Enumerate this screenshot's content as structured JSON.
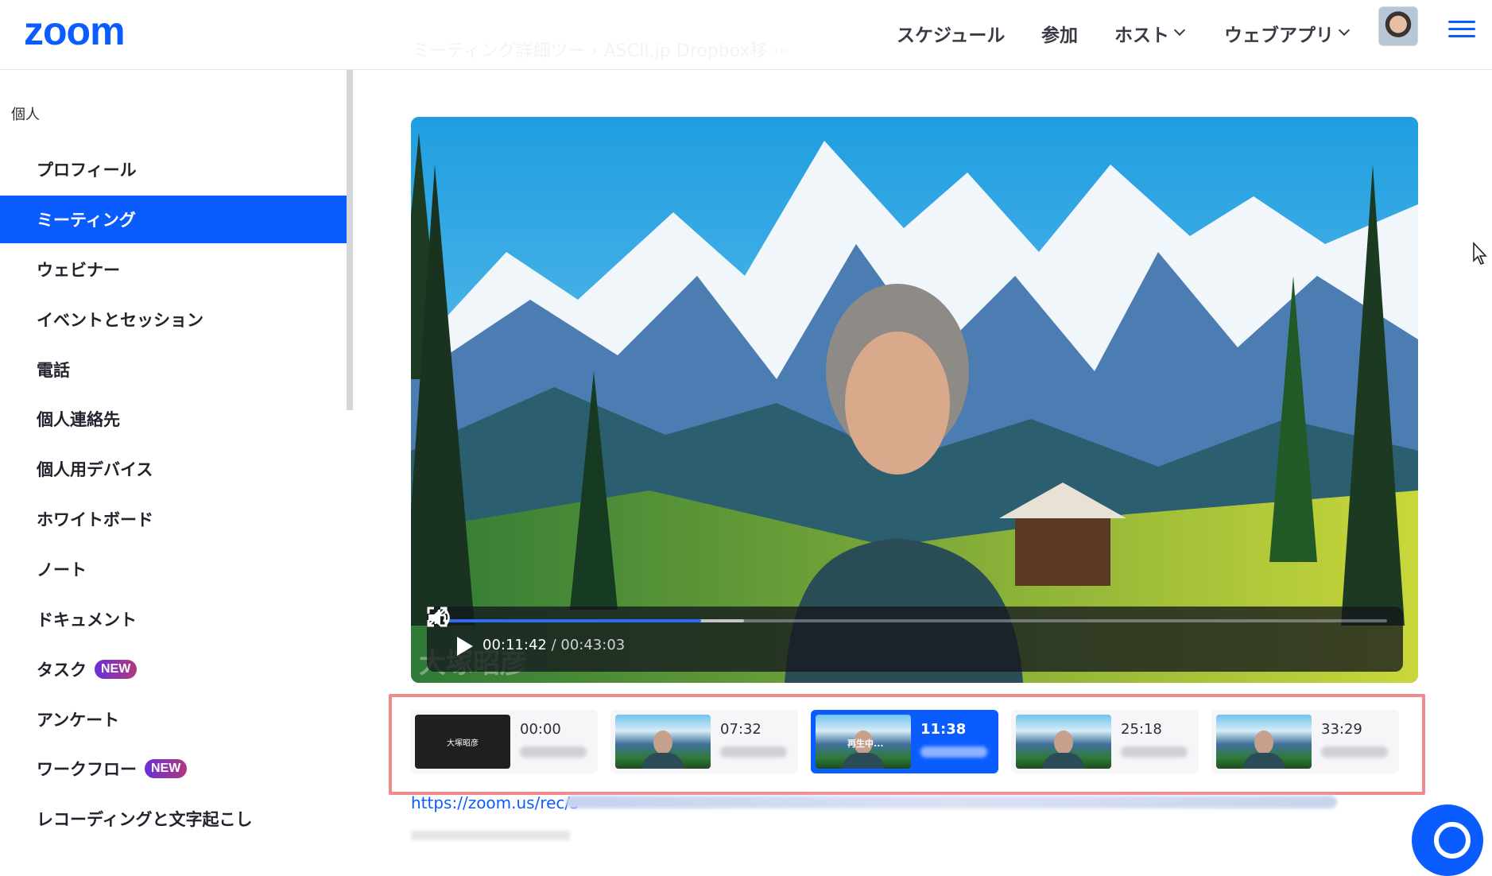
{
  "header": {
    "logo": "zoom",
    "ghost_breadcrumb": "ミーティング詳細ツー  ›  ASCII.jp Dropbox移 ⋯",
    "nav": {
      "schedule": "スケジュール",
      "join": "参加",
      "host": "ホスト",
      "webapp": "ウェブアプリ"
    }
  },
  "sidebar": {
    "section": "個人",
    "items": [
      {
        "label": "プロフィール"
      },
      {
        "label": "ミーティング",
        "active": true
      },
      {
        "label": "ウェビナー"
      },
      {
        "label": "イベントとセッション"
      },
      {
        "label": "電話"
      },
      {
        "label": "個人連絡先"
      },
      {
        "label": "個人用デバイス"
      },
      {
        "label": "ホワイトボード"
      },
      {
        "label": "ノート"
      },
      {
        "label": "ドキュメント"
      },
      {
        "label": "タスク",
        "badge": "NEW"
      },
      {
        "label": "アンケート"
      },
      {
        "label": "ワークフロー",
        "badge": "NEW"
      },
      {
        "label": "レコーディングと文字起こし"
      }
    ]
  },
  "player": {
    "current_time": "00:11:42",
    "separator": "/",
    "total_time": "00:43:03",
    "progress_fraction": 0.272,
    "buffered_fraction": 0.267,
    "speaker_name": "大塚昭彦"
  },
  "chapters": [
    {
      "time": "00:00",
      "thumb_text": "大塚昭彦",
      "type": "dark"
    },
    {
      "time": "07:32",
      "type": "mountain"
    },
    {
      "time": "11:38",
      "thumb_text": "再生中...",
      "type": "mountain",
      "active": true
    },
    {
      "time": "25:18",
      "type": "mountain"
    },
    {
      "time": "33:29",
      "type": "mountain"
    }
  ],
  "recording_link": "https://zoom.us/rec/s",
  "colors": {
    "brand": "#0b5cff",
    "highlight_box": "#ef8a8f",
    "badge_gradient_start": "#6b2fd8",
    "badge_gradient_end": "#b0397c"
  }
}
